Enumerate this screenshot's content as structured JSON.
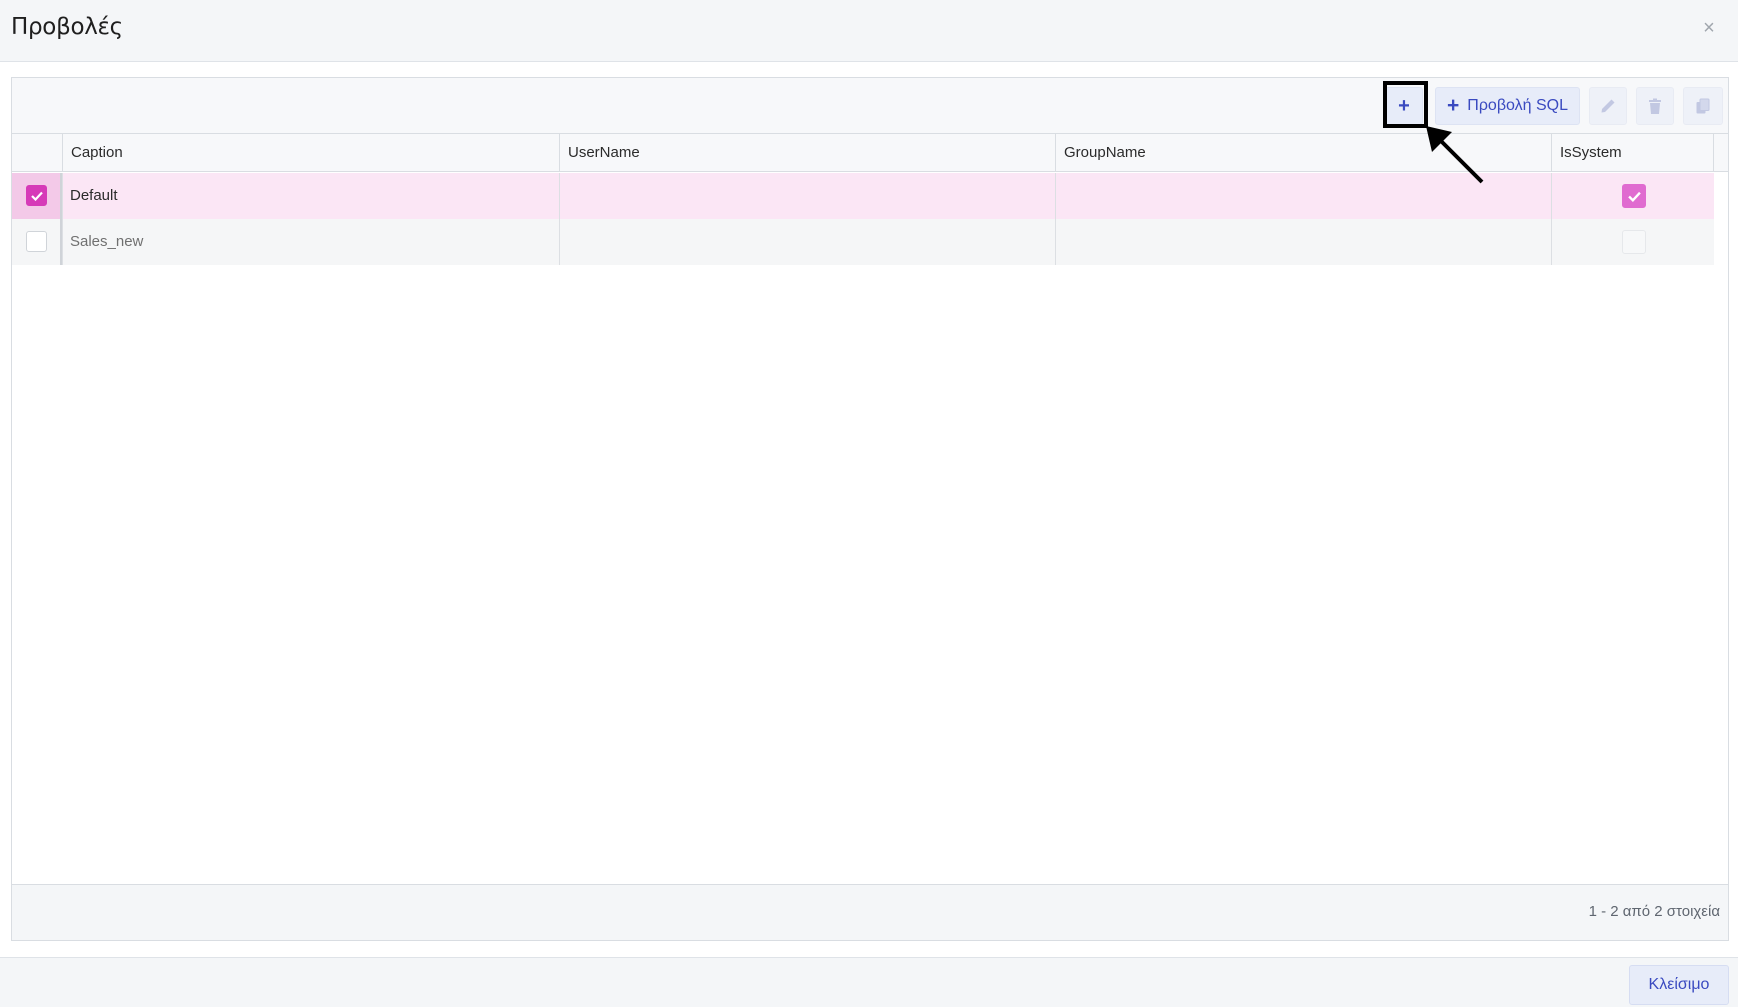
{
  "dialog": {
    "title": "Προβολές",
    "close_icon": "close-icon"
  },
  "toolbar": {
    "add_glyph": "+",
    "add_sql_glyph": "+",
    "add_sql_label": "Προβολή SQL",
    "edit_icon": "pencil-icon",
    "delete_icon": "trash-icon",
    "copy_icon": "copy-icon"
  },
  "table": {
    "columns": [
      "Caption",
      "UserName",
      "GroupName",
      "IsSystem"
    ],
    "rows": [
      {
        "selected": true,
        "caption": "Default",
        "username": "",
        "groupname": "",
        "is_system": true
      },
      {
        "selected": false,
        "caption": "Sales_new",
        "username": "",
        "groupname": "",
        "is_system": false
      }
    ]
  },
  "pager": {
    "info": "1 - 2 από 2 στοιχεία"
  },
  "footer": {
    "close_label": "Κλείσιμο"
  },
  "colors": {
    "accent": "#3a4ac0",
    "selected_row": "#fbe6f5",
    "checkbox_on": "#d63ab8"
  }
}
